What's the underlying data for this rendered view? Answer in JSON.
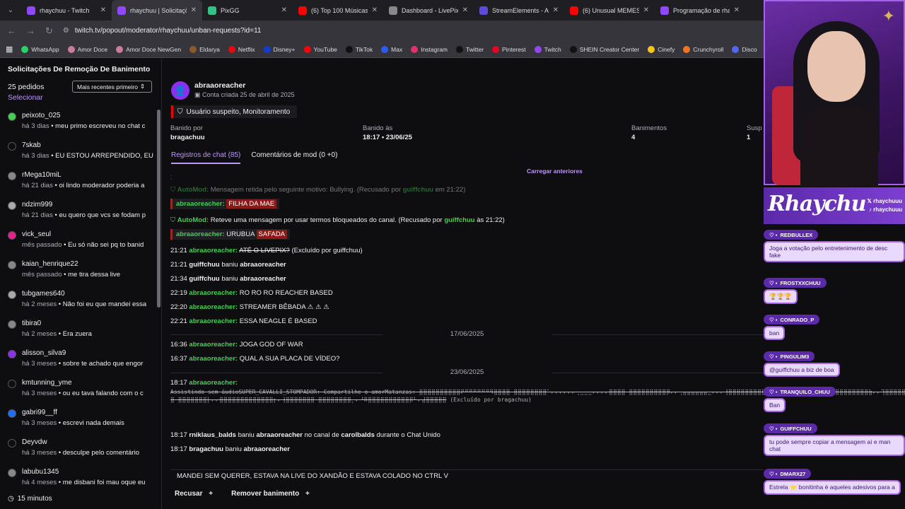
{
  "browser": {
    "tabs": [
      {
        "title": "rhaychuu - Twitch",
        "icon": "twitch-icon",
        "color": "#9146ff"
      },
      {
        "title": "rhaychuu | Solicitaçõ",
        "icon": "twitch-icon",
        "color": "#9146ff",
        "active": true
      },
      {
        "title": "PixGG",
        "icon": "pixgg-icon",
        "color": "#32c285"
      },
      {
        "title": "(6) Top 100 Músicas",
        "icon": "youtube-icon",
        "color": "#ff0000"
      },
      {
        "title": "Dashboard - LivePix",
        "icon": "globe-icon",
        "color": "#888"
      },
      {
        "title": "StreamElements - Ac",
        "icon": "streamelements-icon",
        "color": "#5b4bd6"
      },
      {
        "title": "(6) Unusual MEMES",
        "icon": "youtube-icon",
        "color": "#ff0000"
      },
      {
        "title": "Programação de rha",
        "icon": "twitch-icon",
        "color": "#9146ff"
      }
    ],
    "url": "twitch.tv/popout/moderator/rhaychuu/unban-requests?id=11",
    "bookmarks": [
      "WhatsApp",
      "Amor Doce",
      "Amor Doce NewGen",
      "Eldarya",
      "Netflix",
      "Disney+",
      "YouTube",
      "TikTok",
      "Max",
      "Instagram",
      "Twitter",
      "Pinterest",
      "Twitch",
      "SHEIN Creator Center",
      "Cinefy",
      "Crunchyroll",
      "Disco"
    ]
  },
  "panel": {
    "title": "Solicitações De Remoção De Banimento",
    "count": "25 pedidos",
    "select": "Selecionar",
    "sort": "Mais recentes primeiro",
    "timer": "15 minutos",
    "requests": [
      {
        "name": "peixoto_025",
        "ago": "há 3 dias",
        "msg": "meu primo escreveu no chat c",
        "color": "#42d151"
      },
      {
        "name": "7skab",
        "ago": "há 3 dias",
        "msg": "EU ESTOU ARREPENDIDO, EU",
        "color": "#0e0e10"
      },
      {
        "name": "rMega10miL",
        "ago": "há 21 dias",
        "msg": "oi lindo moderador poderia a",
        "color": "#888"
      },
      {
        "name": "ndzim999",
        "ago": "há 21 dias",
        "msg": "eu quero que vcs se fodam p",
        "color": "#aaa"
      },
      {
        "name": "vick_seul",
        "ago": "mês passado",
        "msg": "Eu só não sei pq to banid",
        "color": "#e91e90"
      },
      {
        "name": "kaian_henrique22",
        "ago": "mês passado",
        "msg": "me tira dessa live",
        "color": "#888"
      },
      {
        "name": "tubgames640",
        "ago": "há 2 meses",
        "msg": "Não foi eu que mandei essa",
        "color": "#aaa"
      },
      {
        "name": "tibira0",
        "ago": "há 2 meses",
        "msg": "Era zuera",
        "color": "#888"
      },
      {
        "name": "alisson_silva9",
        "ago": "há 3 meses",
        "msg": "sobre te achado que engor",
        "color": "#8b2ff0"
      },
      {
        "name": "kmtunning_yme",
        "ago": "há 3 meses",
        "msg": "ou eu tava falando com o c",
        "color": "#0e0e10"
      },
      {
        "name": "gabri99__ff",
        "ago": "há 3 meses",
        "msg": "escrevi nada demais",
        "color": "#1e6fff"
      },
      {
        "name": "Deyvdw",
        "ago": "há 3 meses",
        "msg": "desculpe pelo comentário",
        "color": "#0e0e10"
      },
      {
        "name": "labubu1345",
        "ago": "há 4 meses",
        "msg": "me disbani foi mau oque eu",
        "color": "#888"
      }
    ]
  },
  "user": {
    "name": "abraaoreacher",
    "created": "Conta criada 25 de abril de 2025",
    "flag": "Usuário suspeito, Monitoramento",
    "banned_by_label": "Banido por",
    "banned_by": "bragachuu",
    "banned_at_label": "Banido às",
    "banned_at": "18:17 • 23/06/25",
    "bans_label": "Banimentos",
    "bans": "4",
    "susp_label": "Susp",
    "susp": "1",
    "tab_chat": "Registros de chat (85)",
    "tab_mod": "Comentários de mod (0 +0)",
    "load_more": "Carregar anteriores"
  },
  "log": {
    "automod1": "AutoMod:",
    "automod1_text": "Mensagem retida pelo seguinte motivo: Bullying. (Recusado por",
    "automod1_by": "guiffchuu",
    "automod1_end": "em 21:22)",
    "m1_user": "abraaoreacher:",
    "m1_text": "FILHA DA MAE",
    "automod2": "AutoMod:",
    "automod2_text": "Reteve uma mensagem por usar termos bloqueados do canal. (Recusado por",
    "automod2_by": "guiffchuu",
    "automod2_end": "às 21:22)",
    "m2_user": "abraaoreacher:",
    "m2_text": "URUBUA",
    "m2_red": "SAFADA",
    "r1_time": "21:21",
    "r1_user": "abraaoreacher:",
    "r1_text": "ATÉ O LIVEPIX?",
    "r1_end": "(Excluído por guiffchuu)",
    "r2_time": "21:21",
    "r2_user": "guiffchuu",
    "r2_mid": "baniu",
    "r2_target": "abraaoreacher",
    "r3_time": "21:34",
    "r3_user": "guiffchuu",
    "r3_mid": "baniu",
    "r3_target": "abraaoreacher",
    "r4_time": "22:19",
    "r4_user": "abraaoreacher:",
    "r4_text": "RO RO RO REACHER BASED",
    "r5_time": "22:20",
    "r5_user": "abraaoreacher:",
    "r5_text": "STREAMER BÊBADA ⚠ ⚠ ⚠",
    "r6_time": "22:21",
    "r6_user": "abraaoreacher:",
    "r6_text": "ESSA NEAGLE É BASED",
    "date1": "17/06/2025",
    "r7_time": "16:36",
    "r7_user": "abraaoreacher:",
    "r7_text": "JOGA GOD OF WAR",
    "r8_time": "16:37",
    "r8_user": "abraaoreacher:",
    "r8_text": "QUAL A SUA PLACA DE VÍDEO?",
    "date2": "23/06/2025",
    "r9_time": "18:17",
    "r9_user": "abraaoreacher:",
    "r9_text": "Assistindo sem áudioSUPER_CAVALLI_STOMPADOR: Compartilhe o amorMatanzas: ⣿⣿⣿⣿⣿⣿⣿⣿⣿⣿⠟⠛⠛⠛⠛⠛⠛⠻⣿⣿⣿⣿ ⣿⣿⣿⣿⣿⣿⣿⣿⠁⠄⠄⠄⠄⠄⠄⢀⣀⣀⣀⠄⠄⠄⠄⣿⣿⣿⣿ ⣿⣿⣿⣿⣿⣿⣿⣿⣿⡿⠄⠄⢀⣤⣤⣤⣤⣤⣤⣀⠄⠄⠄⢸⣿⣿⣿⣿⣿⣿⣿⣿⣿⣿⣿ ⣿⣿⣿⣿⣿⣿⣿⡟⠄⠄⣸⣿⣿⣿⣿⣿⣿⣿⣿⣿⣿⣿⣷⠄⠄⢹⣿⣿⣿⣿⣿⣿ ⣿⣿⣿⣿⣿⣿⣿⡇⠄⠄⣿⣿⣿⣿⣿⣿⣿⣿⣿⣿⣿⣿⣿⡆⠄⢸⣿⣿⣿⣿⣿⣿⣿ ⣿⣿⣿⣿⣿⣿⣿⣿⡀⠄⠘⠿⣿⣿⣿⣿⣿⣿⣿⣿⣿⣿⡿⠃⠄⣼⣿⣿⣿⣿⣿",
    "r9_end": "(Excluído por bragachuu)",
    "r10_time": "18:17",
    "r10_user": "rniklaus_balds",
    "r10_mid": "baniu",
    "r10_target": "abraaoreacher",
    "r10_mid2": "no canal de",
    "r10_chan": "carolbalds",
    "r10_end": "durante o Chat Unido",
    "r11_time": "18:17",
    "r11_user": "bragachuu",
    "r11_mid": "baniu",
    "r11_target": "abraaoreacher"
  },
  "request_message": "MANDEI SEM QUERER, ESTAVA NA LIVE DO XANDÃO E ESTAVA COLADO NO CTRL V",
  "actions": {
    "deny": "Recusar",
    "unban": "Remover banimento"
  },
  "overlay": {
    "logo": "Rhaychu",
    "social1": "rhaychuuu",
    "social2": "rhaychuuu",
    "messages": [
      {
        "user": "REDBULLEX",
        "text": "Joga a votação pelo entretenimento de desc fake"
      },
      {
        "user": "FROSTXXCHUU",
        "text": "🏆🏆🏆"
      },
      {
        "user": "CONRADO_P",
        "text": "ban"
      },
      {
        "user": "PINGULIM3",
        "text": "@guiffchuu a biz de boa"
      },
      {
        "user": "TRANQUILO_CHUU",
        "text": "Ban"
      },
      {
        "user": "GUIFFCHUU",
        "text": "tu pode sempre copiar a mensagem aí e man chat"
      },
      {
        "user": "DMARX27",
        "text": "Estrela ⭐ bonitinha é aqueles adesivos para a"
      }
    ]
  }
}
